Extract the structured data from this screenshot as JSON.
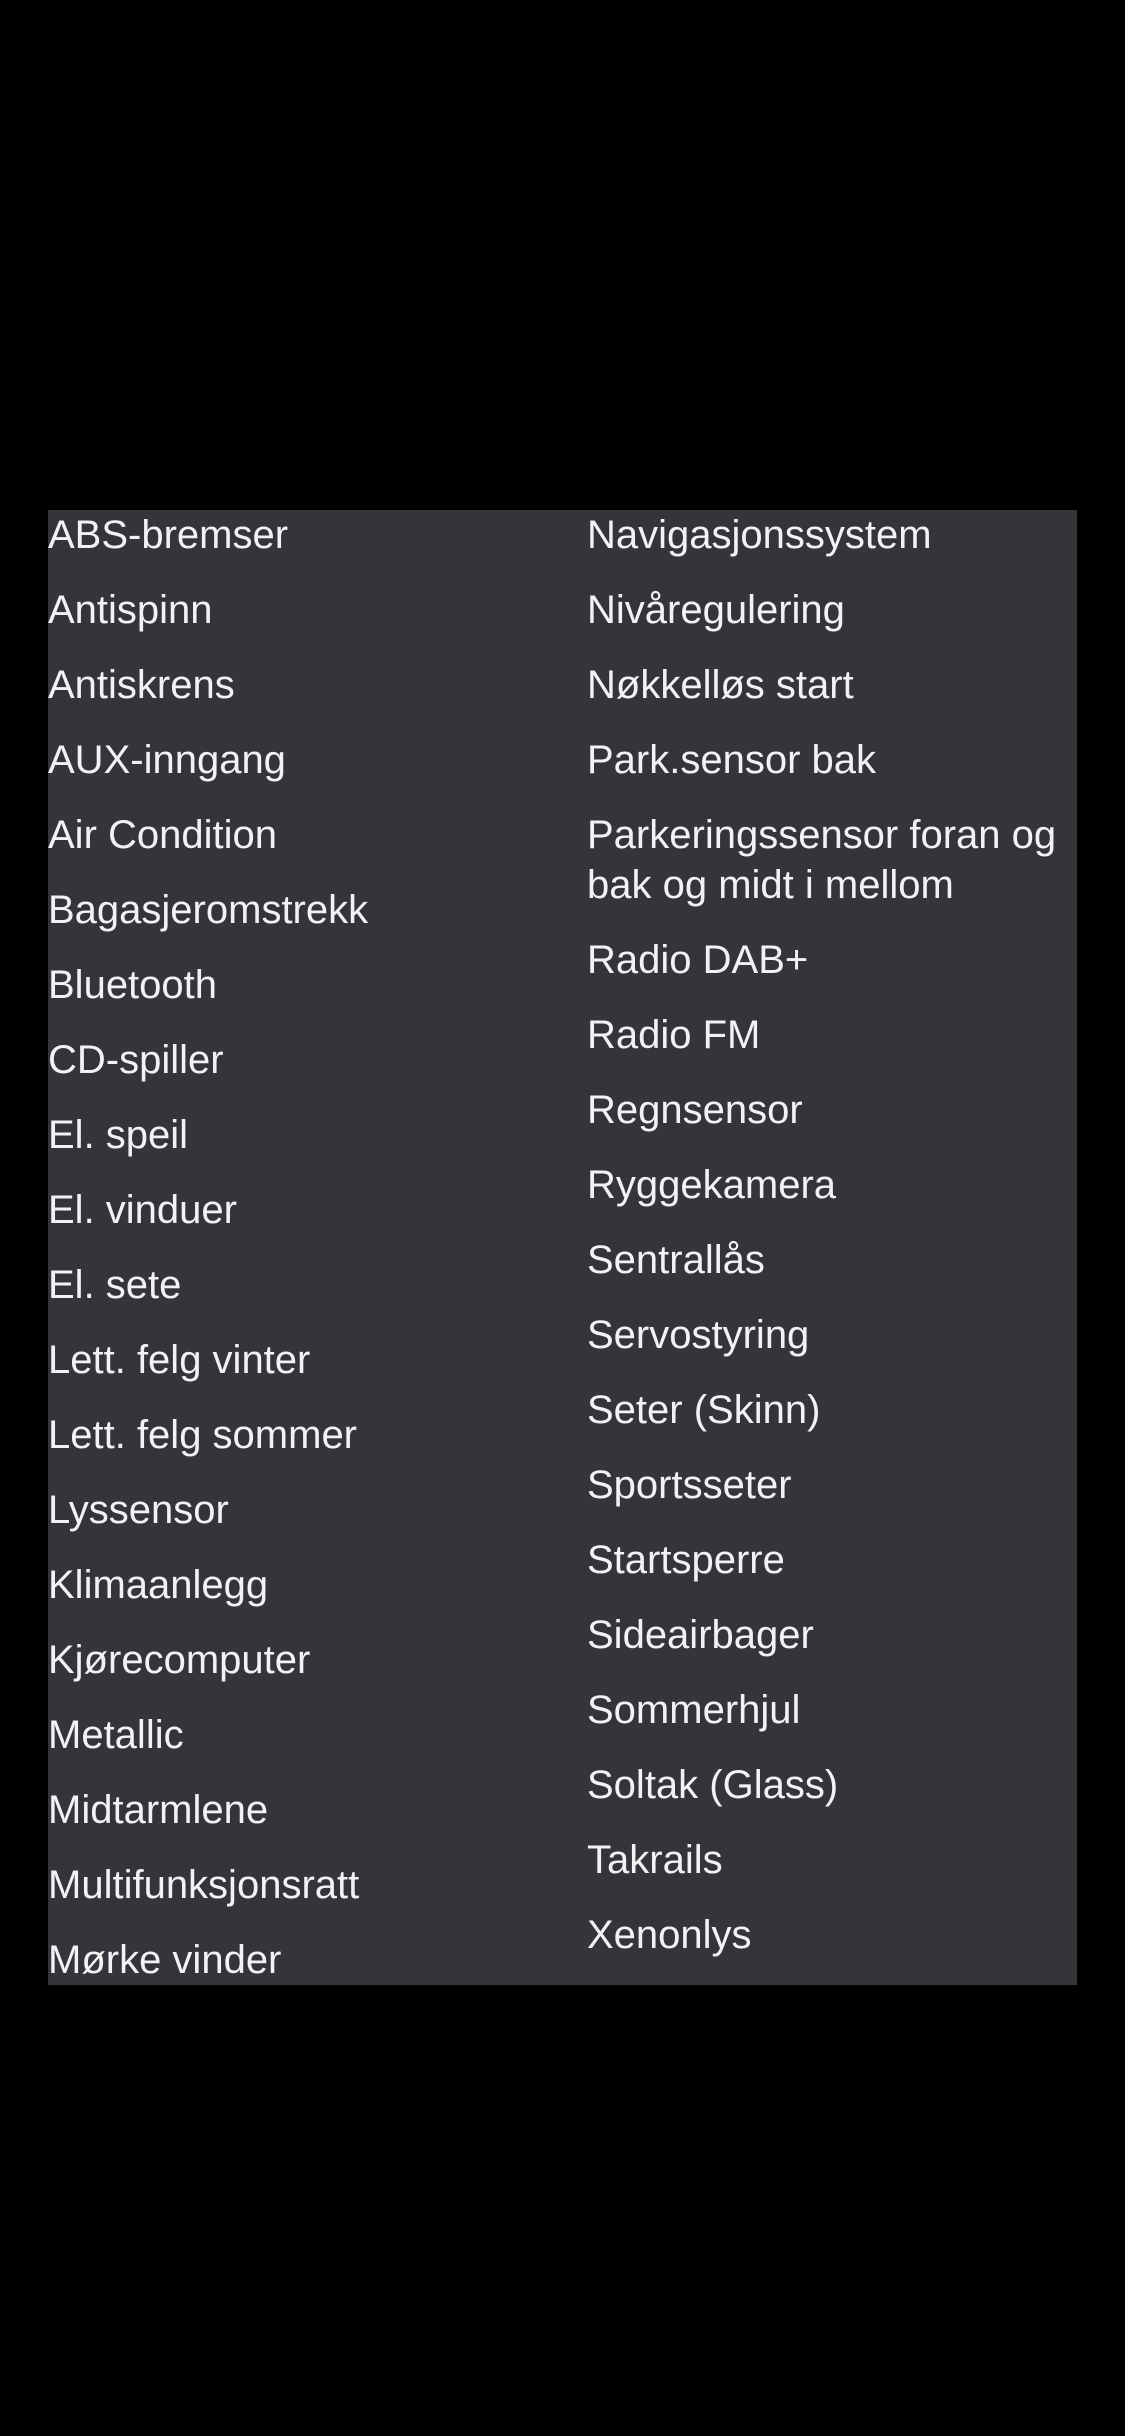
{
  "colors": {
    "background": "#000000",
    "panel": "#353439",
    "text": "#f2f2f4"
  },
  "equipment": {
    "left_column": [
      "ABS-bremser",
      "Antispinn",
      "Antiskrens",
      "AUX-inngang",
      "Air Condition",
      "Bagasjeromstrekk",
      "Bluetooth",
      "CD-spiller",
      "El. speil",
      "El. vinduer",
      "El. sete",
      "Lett. felg vinter",
      "Lett. felg sommer",
      "Lyssensor",
      "Klimaanlegg",
      "Kjørecomputer",
      "Metallic",
      "Midtarmlene",
      "Multifunksjonsratt",
      "Mørke vinder"
    ],
    "right_column": [
      "Navigasjonssystem",
      "Nivåregulering",
      "Nøkkelløs start",
      "Park.sensor bak",
      "Parkeringssensor foran og bak og midt i mellom",
      "Radio DAB+",
      "Radio FM",
      "Regnsensor",
      "Ryggekamera",
      "Sentrallås",
      "Servostyring",
      "Seter (Skinn)",
      "Sportsseter",
      "Startsperre",
      "Sideairbager",
      "Sommerhjul",
      "Soltak (Glass)",
      "Takrails",
      "Xenonlys"
    ]
  }
}
